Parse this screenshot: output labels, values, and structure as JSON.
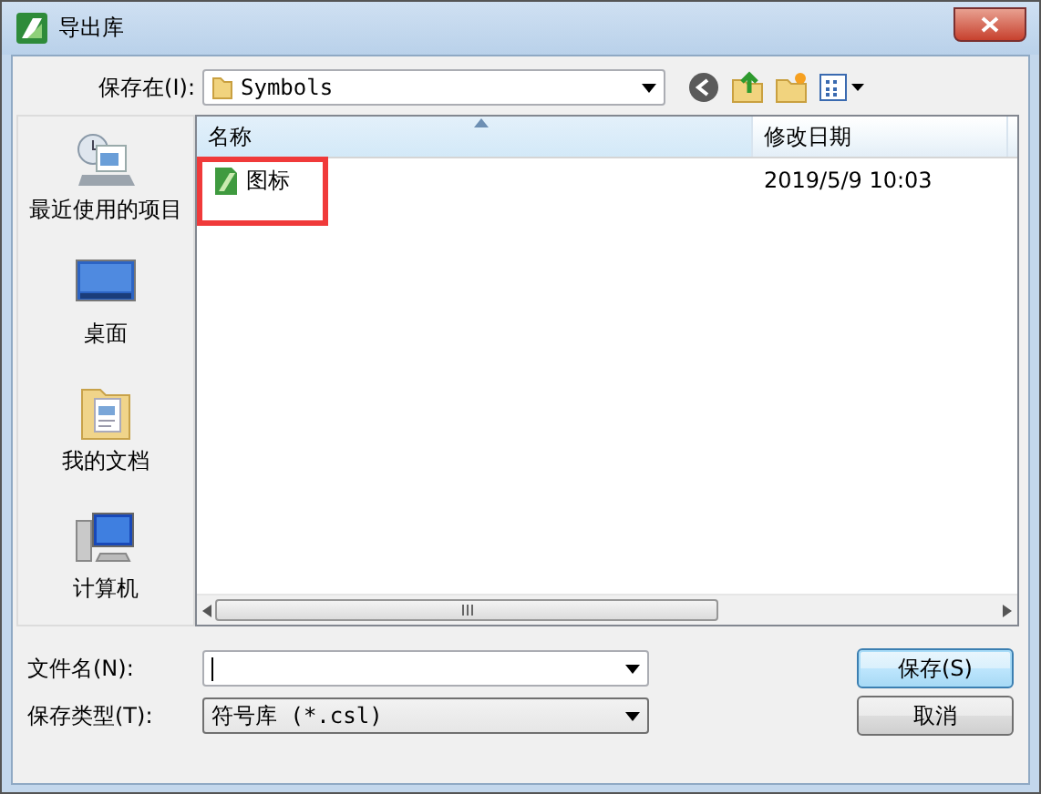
{
  "window": {
    "title": "导出库"
  },
  "save_in": {
    "label": "保存在(I):",
    "value": "Symbols"
  },
  "places": [
    {
      "kind": "recent",
      "label": "最近使用的项目"
    },
    {
      "kind": "desktop",
      "label": "桌面"
    },
    {
      "kind": "documents",
      "label": "我的文档"
    },
    {
      "kind": "computer",
      "label": "计算机"
    }
  ],
  "file_list": {
    "columns": [
      {
        "label": "名称",
        "sorted": true
      },
      {
        "label": "修改日期",
        "sorted": false
      }
    ],
    "rows": [
      {
        "name": "图标",
        "modified": "2019/5/9 10:03",
        "highlighted": true
      }
    ]
  },
  "file_name": {
    "label": "文件名(N):"
  },
  "save_type": {
    "label": "保存类型(T):",
    "value": "符号库 (*.csl)"
  },
  "buttons": [
    {
      "label": "保存(S)",
      "default": true
    },
    {
      "label": "取消",
      "default": false
    }
  ]
}
